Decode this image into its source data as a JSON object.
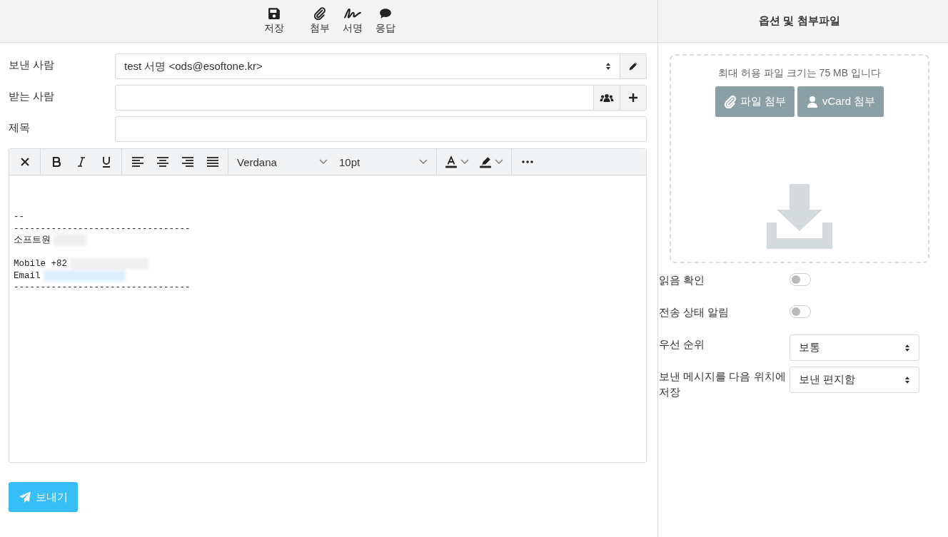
{
  "toolbar": {
    "actions": [
      {
        "kind": "save",
        "label": "저장"
      },
      {
        "kind": "attach",
        "label": "첨부"
      },
      {
        "kind": "signature",
        "label": "서명"
      },
      {
        "kind": "response",
        "label": "응답"
      }
    ]
  },
  "compose": {
    "fields": [
      {
        "kind": "select",
        "label": "보낸 사람",
        "value": "test 서명 <ods@esoftone.kr>"
      },
      {
        "kind": "recipients",
        "label": "받는 사람"
      },
      {
        "kind": "text",
        "label": "제목"
      }
    ],
    "editor": {
      "font": "Verdana",
      "size": "10pt",
      "body": [
        {
          "kind": "blank"
        },
        {
          "kind": "blank"
        },
        {
          "kind": "text",
          "text": "--"
        },
        {
          "kind": "text",
          "text": "---------------------------------"
        },
        {
          "kind": "masked",
          "text": "소프트원"
        },
        {
          "kind": "blank"
        },
        {
          "kind": "maskedwide",
          "text": "Mobile +82"
        },
        {
          "kind": "maskedlink",
          "text": "Email"
        },
        {
          "kind": "text",
          "text": "---------------------------------"
        }
      ]
    },
    "send_button": "보내기"
  },
  "sidebar": {
    "title": "옵션 및 첨부파일",
    "dropzone": {
      "note": "최대 허용 파일 크기는 75 MB 입니다",
      "buttons": [
        {
          "kind": "file",
          "label": "파일 첨부"
        },
        {
          "kind": "vcard",
          "label": "vCard 첨부"
        }
      ]
    },
    "options": [
      {
        "kind": "toggle",
        "label": "읽음 확인",
        "on": false
      },
      {
        "kind": "toggle",
        "label": "전송 상태 알림",
        "on": false
      },
      {
        "kind": "select",
        "label": "우선 순위",
        "value": "보통"
      },
      {
        "kind": "select",
        "label": "보낸 메시지를 다음 위치에 저장",
        "value": "보낸 편지함"
      }
    ]
  }
}
